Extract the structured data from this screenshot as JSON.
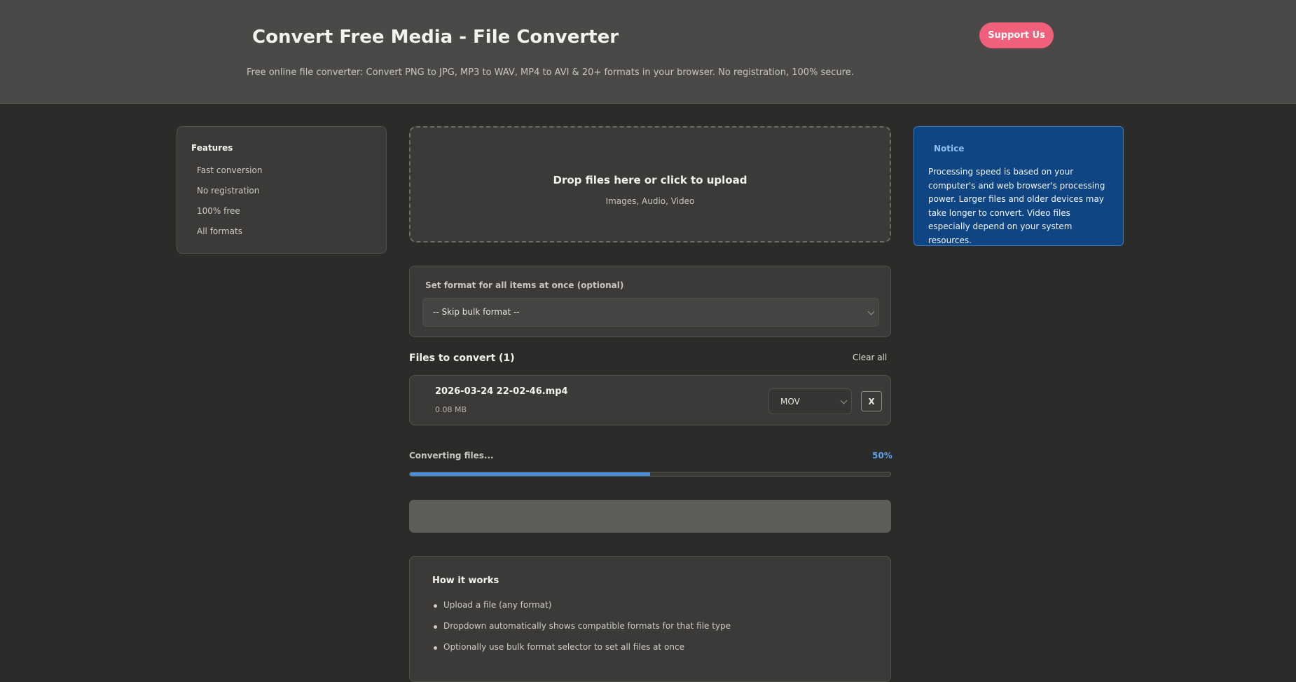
{
  "header": {
    "title": "Convert Free Media - File Converter",
    "description": "Free online file converter: Convert PNG to JPG, MP3 to WAV, MP4 to AVI & 20+ formats in your browser. No registration, 100% secure.",
    "support_label": "Support Us"
  },
  "features": {
    "title": "Features",
    "items": [
      "Fast conversion",
      "No registration",
      "100% free",
      "All formats"
    ]
  },
  "dropzone": {
    "title": "Drop files here or click to upload",
    "subtitle": "Images, Audio, Video"
  },
  "notice": {
    "title": "Notice",
    "text": "Processing speed is based on your computer's and web browser's processing power. Larger files and older devices may take longer to convert. Video files especially depend on your system resources."
  },
  "bulk": {
    "label": "Set format for all items at once (optional)",
    "selected": "-- Skip bulk format --"
  },
  "files": {
    "heading": "Files to convert (1)",
    "clear_label": "Clear all",
    "items": [
      {
        "name": "2026-03-24 22-02-46.mp4",
        "size": "0.08 MB",
        "format": "MOV",
        "remove_label": "X"
      }
    ]
  },
  "progress": {
    "label": "Converting files...",
    "percent_text": "50%",
    "value": 0.5
  },
  "convert_button": {
    "label": ""
  },
  "how_it_works": {
    "title": "How it works",
    "steps": [
      "Upload a file (any format)",
      "Dropdown automatically shows compatible formats for that file type",
      "Optionally use bulk format selector to set all files at once"
    ]
  },
  "colors": {
    "accent": "#f0607a",
    "progress": "#4a8fdc",
    "notice_bg": "#0e4582"
  }
}
